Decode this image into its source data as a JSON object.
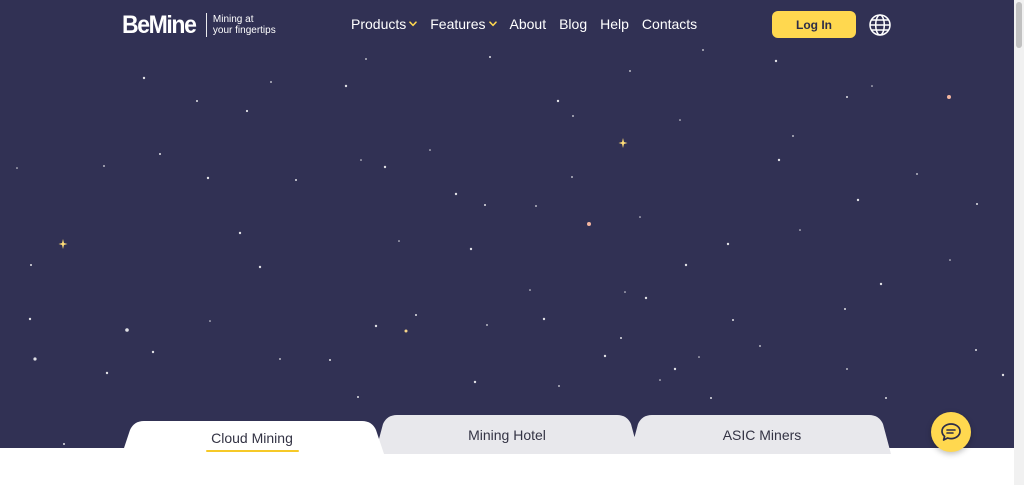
{
  "header": {
    "logo_text": "BeMine",
    "tagline_line1": "Mining at",
    "tagline_line2": "your fingertips",
    "nav": {
      "products": "Products",
      "features": "Features",
      "about": "About",
      "blog": "Blog",
      "help": "Help",
      "contacts": "Contacts"
    },
    "login_label": "Log In",
    "language_icon": "globe-icon"
  },
  "tabs": [
    {
      "label": "Cloud Mining",
      "active": true
    },
    {
      "label": "Mining Hotel",
      "active": false
    },
    {
      "label": "ASIC Miners",
      "active": false
    }
  ],
  "chat_icon": "chat-bubble-icon",
  "colors": {
    "hero_bg": "#313154",
    "accent_yellow": "#ffd84f",
    "inactive_tab": "#e8e8ec",
    "active_tab": "#ffffff"
  }
}
